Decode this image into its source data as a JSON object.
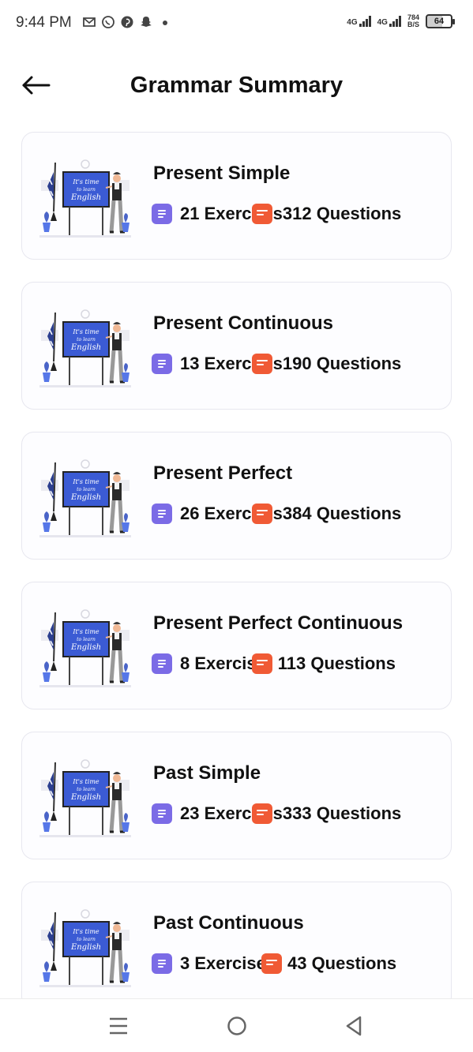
{
  "status_bar": {
    "time": "9:44 PM",
    "notification_icons": [
      "gmail-icon",
      "whatsapp-icon",
      "pinterest-icon",
      "snapchat-icon",
      "dot-icon"
    ],
    "network_1": "4G",
    "network_2": "4G",
    "speed_value": "784",
    "speed_unit": "B/S",
    "battery": "64"
  },
  "header": {
    "title": "Grammar Summary",
    "back_icon": "arrow-left-icon"
  },
  "cards": [
    {
      "title": "Present Simple",
      "exercises": "21 Exerci",
      "questions": "s312 Questions"
    },
    {
      "title": "Present Continuous",
      "exercises": "13 Exerci",
      "questions": "s190 Questions"
    },
    {
      "title": "Present Perfect",
      "exercises": "26 Exerci",
      "questions": "s384 Questions"
    },
    {
      "title": "Present Perfect Continuous",
      "exercises": "8 Exercis",
      "questions": " 113 Questions"
    },
    {
      "title": "Past Simple",
      "exercises": "23 Exerci",
      "questions": "s333 Questions"
    },
    {
      "title": "Past Continuous",
      "exercises": "3 Exercise",
      "questions": " 43 Questions"
    }
  ],
  "thumbnail_board_text": [
    "It's time",
    "to learn",
    "English"
  ],
  "colors": {
    "exercise_icon": "#7b6be6",
    "question_icon": "#f05a35",
    "card_border": "#e7e7ef"
  },
  "nav_bar": {
    "icons": [
      "menu-icon",
      "home-circle-icon",
      "back-triangle-icon"
    ]
  }
}
